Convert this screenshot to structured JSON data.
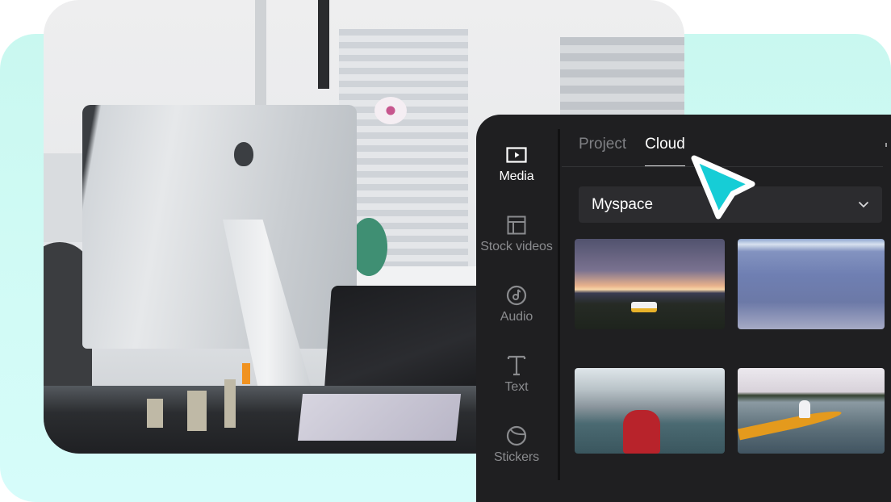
{
  "colors": {
    "background_teal": "#c9f8f0",
    "panel_bg": "#1f1f21",
    "select_bg": "#2c2c2f",
    "active_text": "#ffffff",
    "inactive_text": "#8a8b8e",
    "cursor_fill": "#16cdd6"
  },
  "hero_photo": {
    "description": "Office desk with iMac, laptop and orchid by a window"
  },
  "editor": {
    "sidebar": {
      "items": [
        {
          "label": "Media",
          "icon": "play-box-icon",
          "active": true
        },
        {
          "label": "Stock videos",
          "icon": "layout-icon",
          "active": false
        },
        {
          "label": "Audio",
          "icon": "music-note-icon",
          "active": false
        },
        {
          "label": "Text",
          "icon": "text-t-icon",
          "active": false
        },
        {
          "label": "Stickers",
          "icon": "sticker-icon",
          "active": false
        }
      ]
    },
    "tabs": [
      {
        "label": "Project",
        "active": false
      },
      {
        "label": "Cloud",
        "active": true
      }
    ],
    "space_select": {
      "value": "Myspace",
      "icon": "chevron-down-icon"
    },
    "media_grid": [
      {
        "alt": "Camper van on a hill at sunset over the sea"
      },
      {
        "alt": "Wet beach shoreline with pebbles at dusk"
      },
      {
        "alt": "Person in red jacket canoeing on a snowy river"
      },
      {
        "alt": "Person paddling a yellow kayak on a lake"
      }
    ]
  },
  "cursor": {
    "icon": "pointer-arrow-icon"
  }
}
